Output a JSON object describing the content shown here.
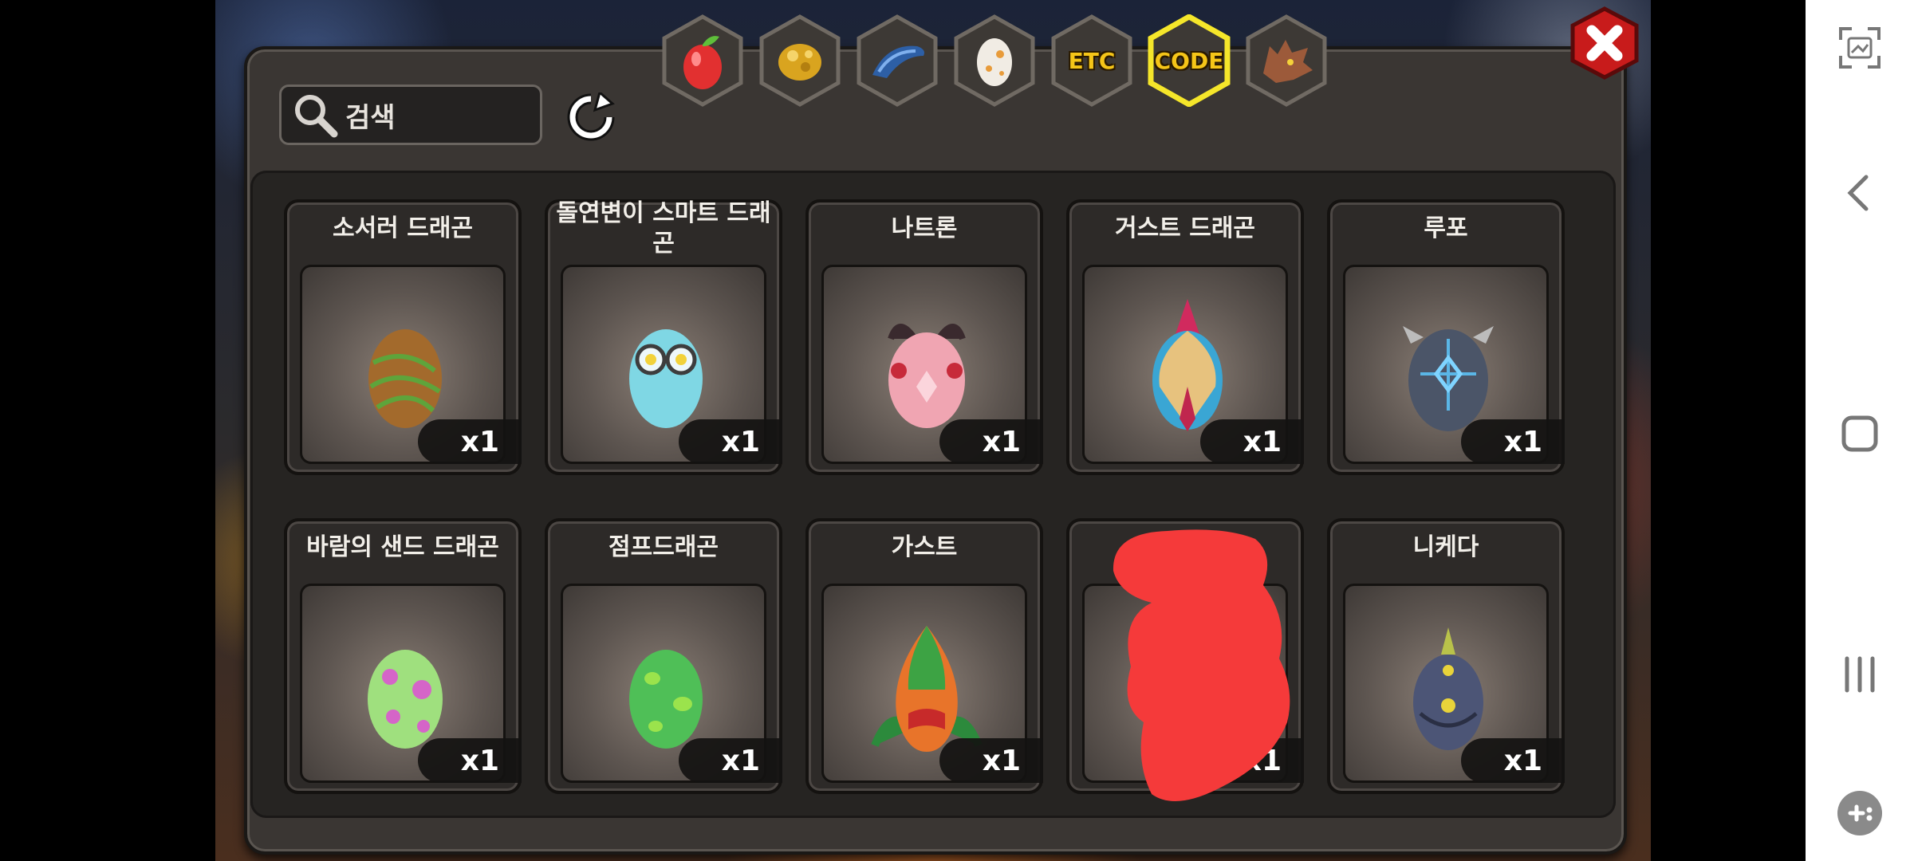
{
  "search": {
    "placeholder": "검색"
  },
  "tabs": [
    {
      "name": "fruit-tab",
      "label": "",
      "selected": false
    },
    {
      "name": "gold-tab",
      "label": "",
      "selected": false
    },
    {
      "name": "fish-tab",
      "label": "",
      "selected": false
    },
    {
      "name": "egg-tab",
      "label": "",
      "selected": false
    },
    {
      "name": "etc-tab",
      "label": "ETC",
      "selected": false
    },
    {
      "name": "code-tab",
      "label": "CODE",
      "selected": true
    },
    {
      "name": "dragon-tab",
      "label": "",
      "selected": false
    }
  ],
  "items": [
    {
      "name": "소서러 드래곤",
      "qty": "x1",
      "icon": "sorcerer-dragon-egg-icon"
    },
    {
      "name": "돌연변이 스마트 드래곤",
      "qty": "x1",
      "icon": "smart-dragon-egg-icon"
    },
    {
      "name": "나트론",
      "qty": "x1",
      "icon": "natron-egg-icon"
    },
    {
      "name": "거스트 드래곤",
      "qty": "x1",
      "icon": "gust-dragon-egg-icon"
    },
    {
      "name": "루포",
      "qty": "x1",
      "icon": "lupo-egg-icon"
    },
    {
      "name": "바람의 샌드 드래곤",
      "qty": "x1",
      "icon": "wind-sand-dragon-egg-icon"
    },
    {
      "name": "점프드래곤",
      "qty": "x1",
      "icon": "jump-dragon-egg-icon"
    },
    {
      "name": "가스트",
      "qty": "x1",
      "icon": "gast-egg-icon"
    },
    {
      "name": "",
      "qty": "x1",
      "icon": "redacted-egg-icon"
    },
    {
      "name": "니케다",
      "qty": "x1",
      "icon": "nikeda-egg-icon"
    }
  ],
  "colors": {
    "tab_selected_border": "#f5e62a",
    "tab_label": "#f5c518",
    "redaction": "#f53a3a",
    "close_button": "#d81f1f"
  }
}
